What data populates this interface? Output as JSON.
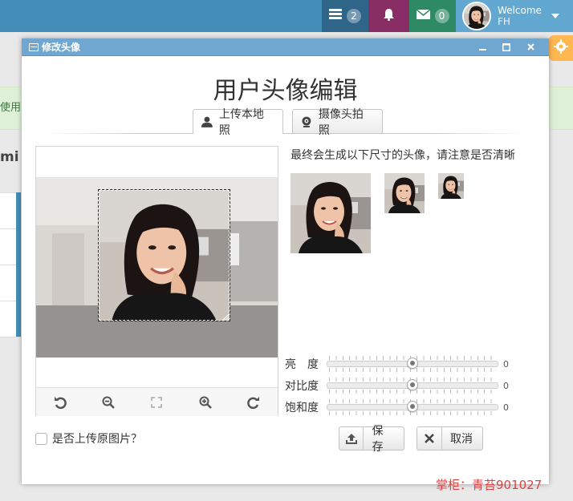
{
  "header": {
    "tasks_badge": "2",
    "mail_badge": "0",
    "welcome_label": "Welcome",
    "user_name": "FH"
  },
  "background": {
    "alert_fragment": "使用",
    "heading_fragment": "mi"
  },
  "dialog": {
    "title_bar": "修改头像",
    "heading": "用户头像编辑",
    "tabs": [
      {
        "label": "上传本地照",
        "icon": "user-icon",
        "active": true
      },
      {
        "label": "摄像头拍照",
        "icon": "webcam-icon",
        "active": false
      }
    ],
    "hint": "最终会生成以下尺寸的头像，请注意是否清晰",
    "sliders": [
      {
        "label": "亮　度",
        "value": "0",
        "position": 0.5
      },
      {
        "label": "对比度",
        "value": "0",
        "position": 0.5
      },
      {
        "label": "饱和度",
        "value": "0",
        "position": 0.5
      }
    ],
    "upload_original_label": "是否上传原图片？",
    "save_label": "保存",
    "cancel_label": "取消",
    "crop_tools": [
      "rotate-left-icon",
      "zoom-out-icon",
      "fit-icon",
      "zoom-in-icon",
      "rotate-right-icon"
    ]
  },
  "watermark": "掌柜：青苔901027",
  "colors": {
    "topbar": "#438eb9",
    "dialog_header": "#6fa7d1",
    "watermark": "#e04040"
  }
}
